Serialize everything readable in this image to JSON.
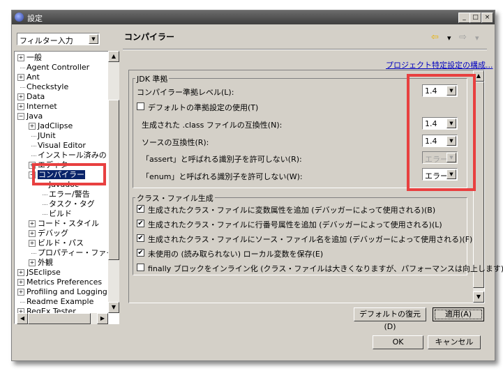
{
  "window": {
    "title": "設定",
    "min": "_",
    "max": "□",
    "close": "×"
  },
  "filter": {
    "value": "フィルター入力"
  },
  "tree": {
    "items": [
      {
        "label": "一般",
        "exp": "+"
      },
      {
        "label": "Agent Controller",
        "exp": ""
      },
      {
        "label": "Ant",
        "exp": "+"
      },
      {
        "label": "Checkstyle",
        "exp": ""
      },
      {
        "label": "Data",
        "exp": "+"
      },
      {
        "label": "Internet",
        "exp": "+"
      },
      {
        "label": "Java",
        "exp": "−"
      },
      {
        "label": "JadClipse",
        "exp": "+"
      },
      {
        "label": "JUnit",
        "exp": ""
      },
      {
        "label": "Visual Editor",
        "exp": ""
      },
      {
        "label": "インストール済みの",
        "exp": ""
      },
      {
        "label": "エディター",
        "exp": "+"
      },
      {
        "label": "コンパイラー",
        "exp": "−"
      },
      {
        "label": "Javadoc",
        "exp": ""
      },
      {
        "label": "エラー/警告",
        "exp": ""
      },
      {
        "label": "タスク・タグ",
        "exp": ""
      },
      {
        "label": "ビルド",
        "exp": ""
      },
      {
        "label": "コード・スタイル",
        "exp": "+"
      },
      {
        "label": "デバッグ",
        "exp": "+"
      },
      {
        "label": "ビルド・パス",
        "exp": "+"
      },
      {
        "label": "プロパティー・ファイ",
        "exp": ""
      },
      {
        "label": "外観",
        "exp": "+"
      },
      {
        "label": "JSEclipse",
        "exp": "+"
      },
      {
        "label": "Metrics Preferences",
        "exp": "+"
      },
      {
        "label": "Profiling and Logging",
        "exp": "+"
      },
      {
        "label": "Readme Example",
        "exp": ""
      },
      {
        "label": "RegEx Tester",
        "exp": "+"
      }
    ]
  },
  "header": {
    "title": "コンパイラー",
    "nav_back": "⇦",
    "nav_menu": "▾",
    "nav_fwd": "⇨",
    "nav_menu2": "▾"
  },
  "project_link": "プロジェクト特定設定の構成...",
  "jdk": {
    "group_title": "JDK 準拠",
    "compliance_label": "コンパイラー準拠レベル(L):",
    "compliance_value": "1.4",
    "default_label": "デフォルトの準拠設定の使用(T)",
    "class_compat_label": "生成された .class ファイルの互換性(N):",
    "class_compat_value": "1.4",
    "source_compat_label": "ソースの互換性(R):",
    "source_compat_value": "1.4",
    "assert_label": "「assert」と呼ばれる識別子を許可しない(R):",
    "assert_value": "エラー",
    "enum_label": "「enum」と呼ばれる識別子を許可しない(W):",
    "enum_value": "エラー"
  },
  "classfile": {
    "group_title": "クラス・ファイル生成",
    "options": [
      {
        "label": "生成されたクラス・ファイルに変数属性を追加 (デバッガーによって使用される)(B)",
        "checked": true
      },
      {
        "label": "生成されたクラス・ファイルに行番号属性を追加 (デバッガーによって使用される)(L)",
        "checked": true
      },
      {
        "label": "生成されたクラス・ファイルにソース・ファイル名を追加 (デバッガーによって使用される)(F)",
        "checked": true
      },
      {
        "label": "未使用の (読み取られない) ローカル変数を保存(E)",
        "checked": true
      },
      {
        "label": "finally ブロックをインライン化 (クラス・ファイルは大きくなりますが、パフォーマンスは向上します)(O)",
        "checked": false
      }
    ]
  },
  "buttons": {
    "restore": "デフォルトの復元(D)",
    "apply": "適用(A)",
    "ok": "OK",
    "cancel": "キャンセル"
  },
  "accent": {
    "highlight": "#e84040",
    "selection": "#0a246a"
  }
}
